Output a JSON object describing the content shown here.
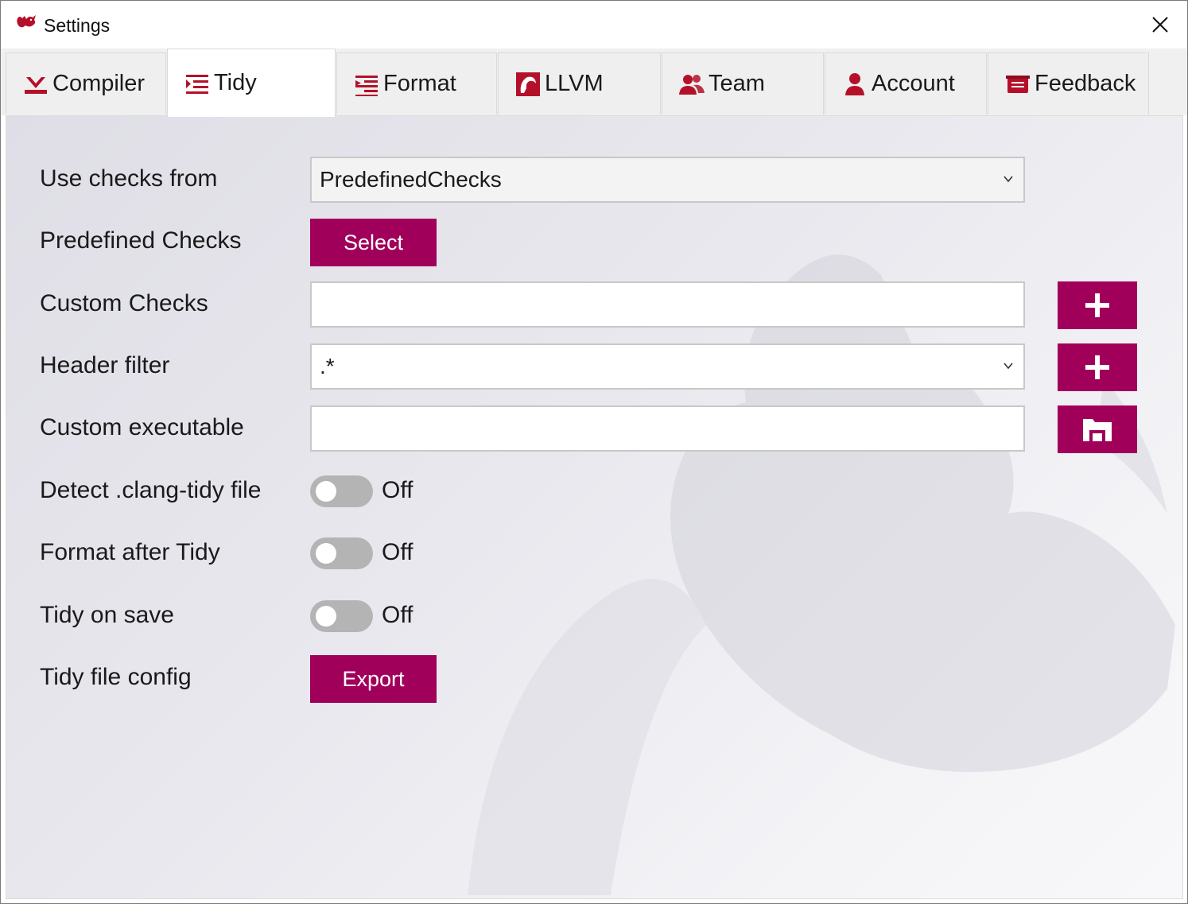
{
  "window": {
    "title": "Settings"
  },
  "tabs": [
    {
      "label": "Compiler",
      "icon": "compiler-icon"
    },
    {
      "label": "Tidy",
      "icon": "tidy-icon",
      "active": true
    },
    {
      "label": "Format",
      "icon": "format-icon"
    },
    {
      "label": "LLVM",
      "icon": "llvm-icon"
    },
    {
      "label": "Team",
      "icon": "team-icon"
    },
    {
      "label": "Account",
      "icon": "account-icon"
    },
    {
      "label": "Feedback",
      "icon": "feedback-icon"
    }
  ],
  "tidy": {
    "use_checks_from": {
      "label": "Use checks from",
      "value": "PredefinedChecks"
    },
    "predefined_checks": {
      "label": "Predefined Checks",
      "button": "Select"
    },
    "custom_checks": {
      "label": "Custom Checks",
      "value": ""
    },
    "header_filter": {
      "label": "Header filter",
      "value": ".*"
    },
    "custom_executable": {
      "label": "Custom executable",
      "value": ""
    },
    "detect_file": {
      "label": "Detect .clang-tidy file",
      "state": "Off"
    },
    "format_after_tidy": {
      "label": "Format after Tidy",
      "state": "Off"
    },
    "tidy_on_save": {
      "label": "Tidy on save",
      "state": "Off"
    },
    "tidy_file_config": {
      "label": "Tidy file config",
      "button": "Export"
    }
  },
  "colors": {
    "accent": "#a0005a",
    "icon_red": "#b5102a",
    "toggle_off": "#b4b4b4"
  }
}
